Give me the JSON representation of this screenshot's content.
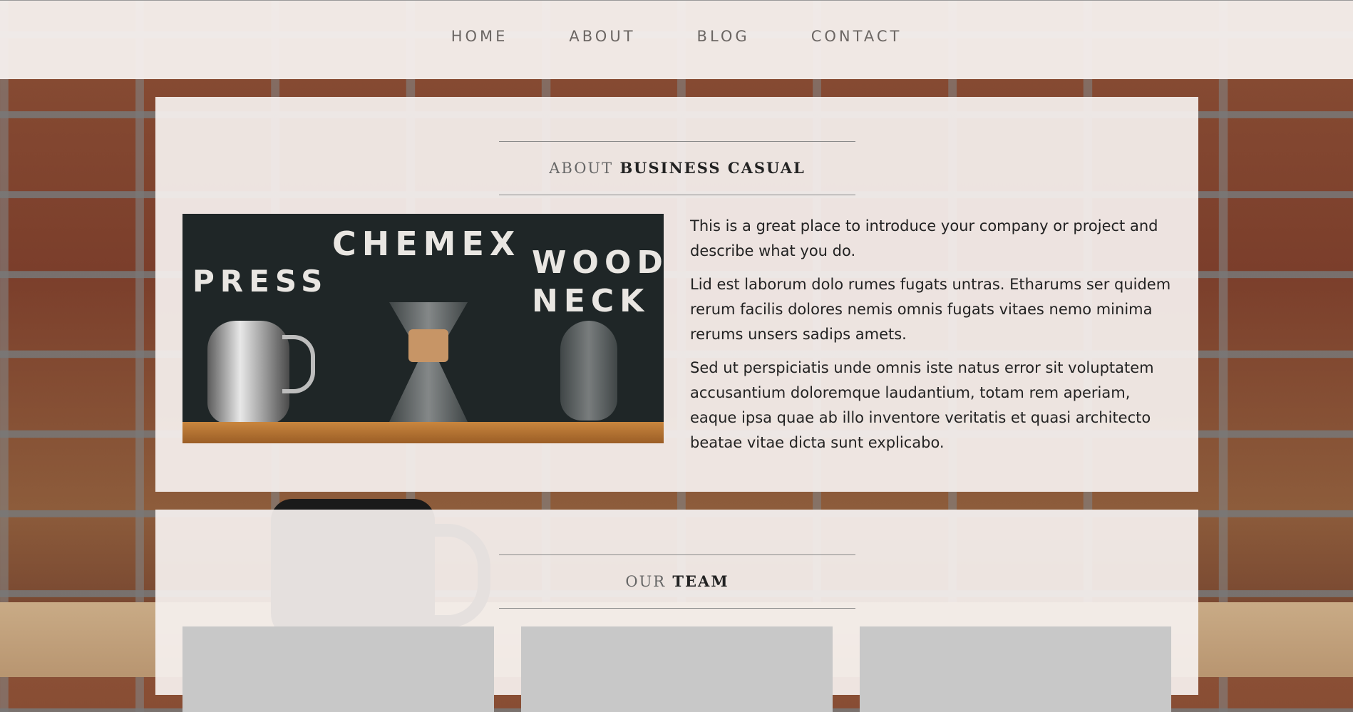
{
  "nav": {
    "items": [
      "HOME",
      "ABOUT",
      "BLOG",
      "CONTACT"
    ]
  },
  "about": {
    "heading_lower": "ABOUT",
    "heading_upper": "BUSINESS CASUAL",
    "image": {
      "labels": [
        "CHEMEX",
        "PRESS",
        "WOOD",
        "NECK"
      ]
    },
    "paragraphs": [
      "This is a great place to introduce your company or project and describe what you do.",
      "Lid est laborum dolo rumes fugats untras. Etharums ser quidem rerum facilis dolores nemis omnis fugats vitaes nemo minima rerums unsers sadips amets.",
      "Sed ut perspiciatis unde omnis iste natus error sit voluptatem accusantium doloremque laudantium, totam rem aperiam, eaque ipsa quae ab illo inventore veritatis et quasi architecto beatae vitae dicta sunt explicabo."
    ]
  },
  "team": {
    "heading_lower": "OUR",
    "heading_upper": "TEAM"
  }
}
